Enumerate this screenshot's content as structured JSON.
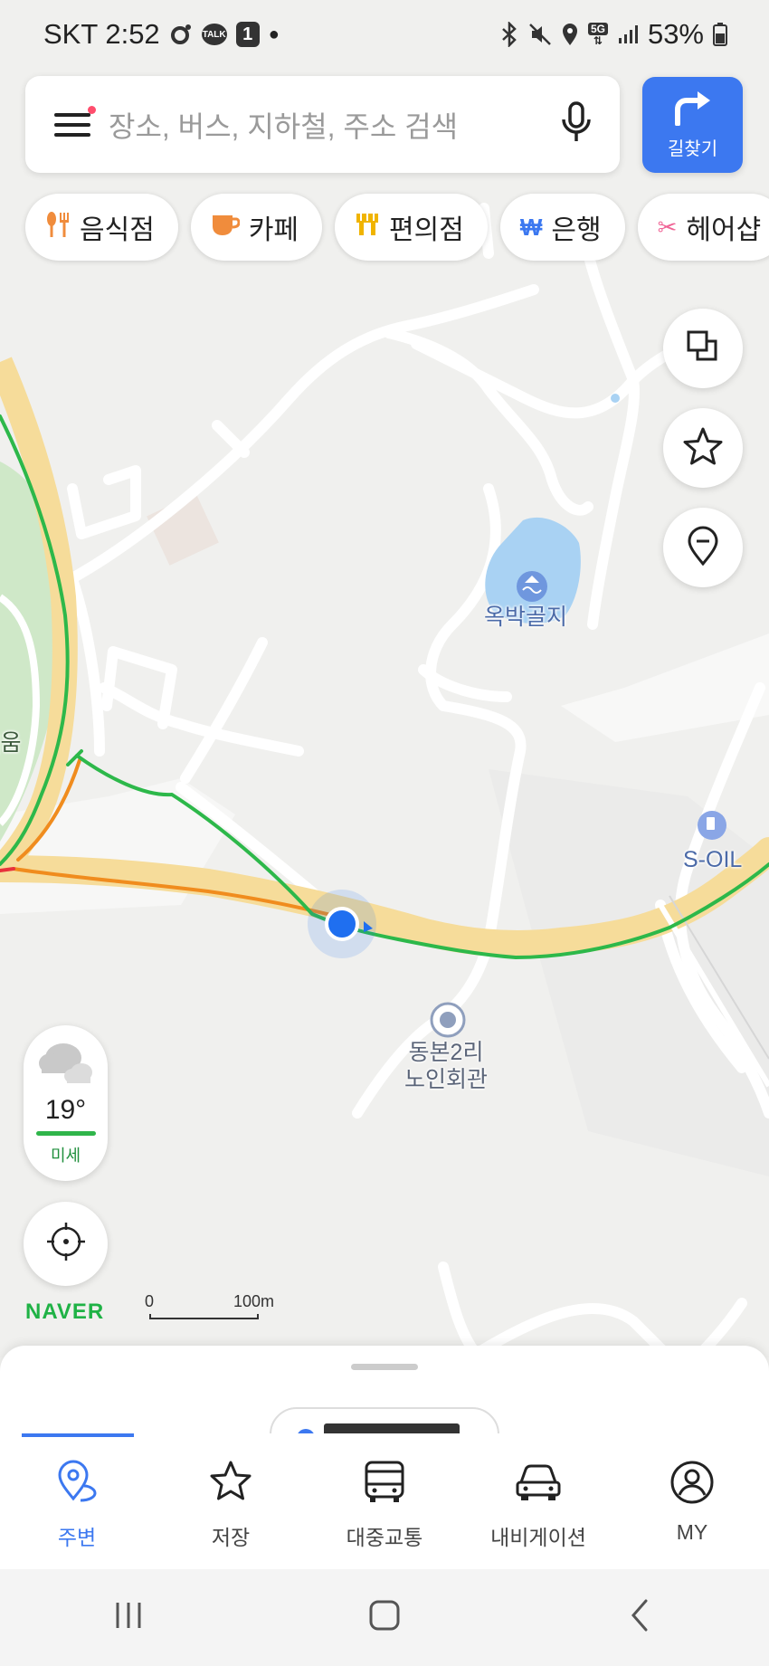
{
  "status_bar": {
    "carrier_time": "SKT 2:52",
    "talk_badge": "TALK",
    "notification_count": "1",
    "network": "5G",
    "battery": "53%"
  },
  "search": {
    "placeholder": "장소, 버스, 지하철, 주소 검색",
    "route_button_label": "길찾기"
  },
  "categories": [
    {
      "label": "음식점",
      "icon": "fork-knife-icon",
      "color": "#f08c3c"
    },
    {
      "label": "카페",
      "icon": "coffee-cup-icon",
      "color": "#f08c3c"
    },
    {
      "label": "편의점",
      "icon": "store-icon",
      "color": "#f0b400"
    },
    {
      "label": "은행",
      "icon": "won-icon",
      "color": "#3c78f0"
    },
    {
      "label": "헤어샵",
      "icon": "scissors-icon",
      "color": "#f06496"
    }
  ],
  "map": {
    "labels": {
      "pond": "옥박골지",
      "gas_station": "S-OIL",
      "senior_center_line1": "동본2리",
      "senior_center_line2": "노인회관",
      "edge_fragment": "|움"
    },
    "colors": {
      "road_major": "#f6dc9a",
      "traffic_good": "#2db84a",
      "traffic_slow": "#f08c1e",
      "traffic_jam": "#e8323c",
      "water": "#a9d2f3",
      "park": "#cfe8c8",
      "location": "#1f6ff0"
    }
  },
  "weather": {
    "temperature": "19°",
    "dust_label": "미세",
    "dust_color": "#2fb54a"
  },
  "brand": {
    "logo": "NAVER",
    "color": "#1fb245"
  },
  "scale": {
    "start": "0",
    "end": "100m"
  },
  "tabs": [
    {
      "label": "주변",
      "icon": "location-pin-icon",
      "active": true
    },
    {
      "label": "저장",
      "icon": "star-icon",
      "active": false
    },
    {
      "label": "대중교통",
      "icon": "bus-icon",
      "active": false
    },
    {
      "label": "내비게이션",
      "icon": "car-icon",
      "active": false
    },
    {
      "label": "MY",
      "icon": "profile-icon",
      "active": false
    }
  ],
  "accent_color": "#3c78f0"
}
